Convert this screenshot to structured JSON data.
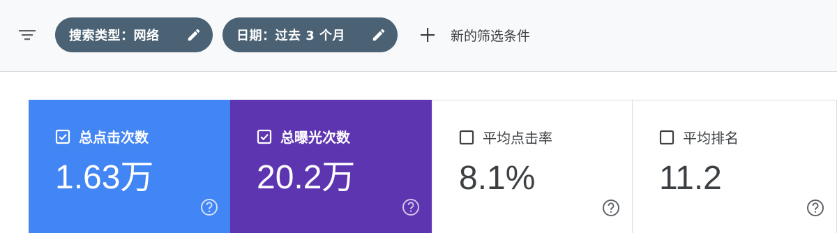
{
  "filters": {
    "chips": [
      {
        "label": "搜索类型：网络",
        "icon": "edit-icon"
      },
      {
        "label": "日期：过去 3 个月",
        "icon": "edit-icon"
      }
    ],
    "new_filter_label": "新的筛选条件"
  },
  "metrics": [
    {
      "label": "总点击次数",
      "value": "1.63万",
      "checked": true,
      "color": "#4285f4"
    },
    {
      "label": "总曝光次数",
      "value": "20.2万",
      "checked": true,
      "color": "#5e35b1"
    },
    {
      "label": "平均点击率",
      "value": "8.1%",
      "checked": false,
      "color": "#ffffff"
    },
    {
      "label": "平均排名",
      "value": "11.2",
      "checked": false,
      "color": "#ffffff"
    }
  ],
  "colors": {
    "chip_bg": "#4a6274",
    "text_dark": "#3c4043",
    "clicks_blue": "#4285f4",
    "impressions_purple": "#5e35b1"
  }
}
